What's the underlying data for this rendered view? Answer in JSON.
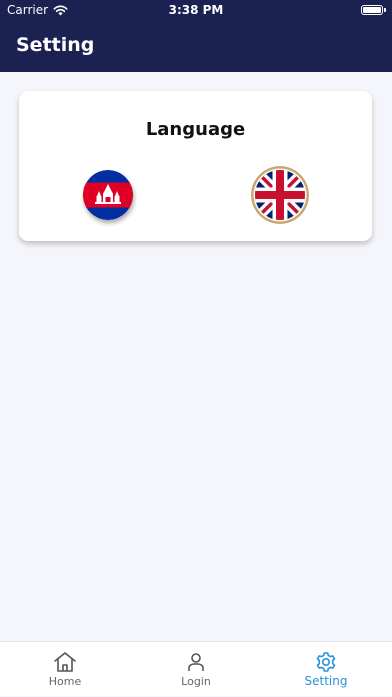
{
  "status_bar": {
    "carrier": "Carrier",
    "time": "3:38 PM"
  },
  "header": {
    "title": "Setting"
  },
  "language_card": {
    "title": "Language",
    "options": [
      {
        "name": "khmer",
        "icon": "cambodia-flag-icon"
      },
      {
        "name": "english",
        "icon": "uk-flag-icon"
      }
    ]
  },
  "tabs": [
    {
      "label": "Home",
      "icon": "home-icon",
      "active": false
    },
    {
      "label": "Login",
      "icon": "user-icon",
      "active": false
    },
    {
      "label": "Setting",
      "icon": "gear-icon",
      "active": true
    }
  ],
  "colors": {
    "header_bg": "#1b2150",
    "active_tab": "#2a93d5",
    "background": "#f5f6fb"
  }
}
